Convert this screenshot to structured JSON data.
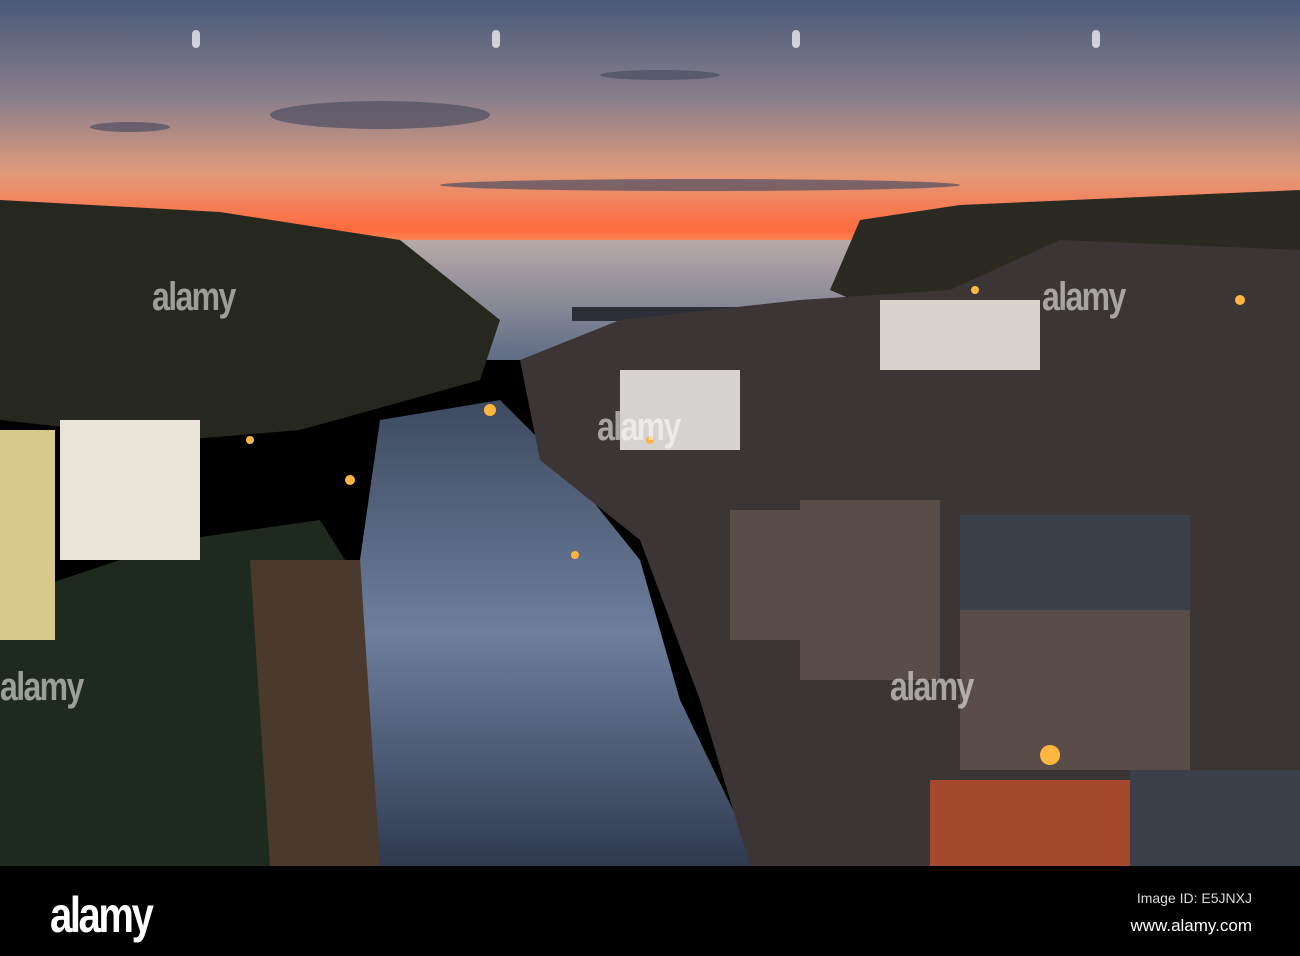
{
  "watermark": {
    "text": "alamy"
  },
  "footer": {
    "logo": "alamy",
    "image_id": "Image ID: E5JNXJ",
    "website": "www.alamy.com"
  },
  "colors": {
    "sky_top": "#4a5a78",
    "sunset": "#ff6a3d",
    "sea": "#7d8aa0",
    "lamp": "#ffb640"
  }
}
